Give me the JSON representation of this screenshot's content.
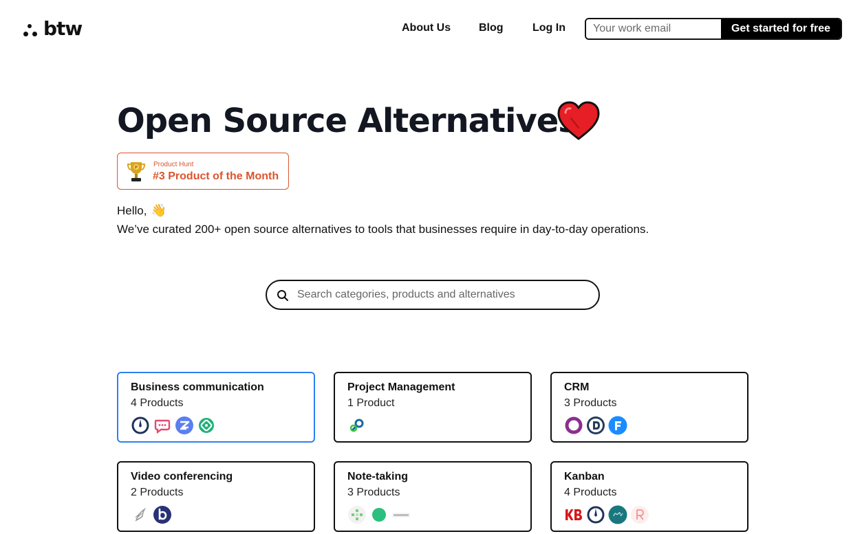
{
  "header": {
    "logo_text": "btw",
    "nav": {
      "about": "About Us",
      "blog": "Blog",
      "login": "Log In"
    },
    "email_placeholder": "Your work email",
    "cta_label": "Get started for free"
  },
  "hero": {
    "title": "Open Source Alternatives",
    "title_emoji": "heart",
    "badge": {
      "small": "Product Hunt",
      "big": "#3 Product of the Month"
    },
    "hello": "Hello,",
    "intro": "We’ve curated 200+ open source alternatives to tools that businesses require in day-to-day operations."
  },
  "search": {
    "placeholder": "Search categories, products and alternatives"
  },
  "categories": [
    {
      "title": "Business communication",
      "count": "4 Products",
      "active": true
    },
    {
      "title": "Project Management",
      "count": "1 Product",
      "active": false
    },
    {
      "title": "CRM",
      "count": "3 Products",
      "active": false
    },
    {
      "title": "Video conferencing",
      "count": "2 Products",
      "active": false
    },
    {
      "title": "Note-taking",
      "count": "3 Products",
      "active": false
    },
    {
      "title": "Kanban",
      "count": "4 Products",
      "active": false
    }
  ],
  "colors": {
    "accent": "#2a80f5",
    "product_hunt": "#da552f",
    "text": "#131722"
  }
}
